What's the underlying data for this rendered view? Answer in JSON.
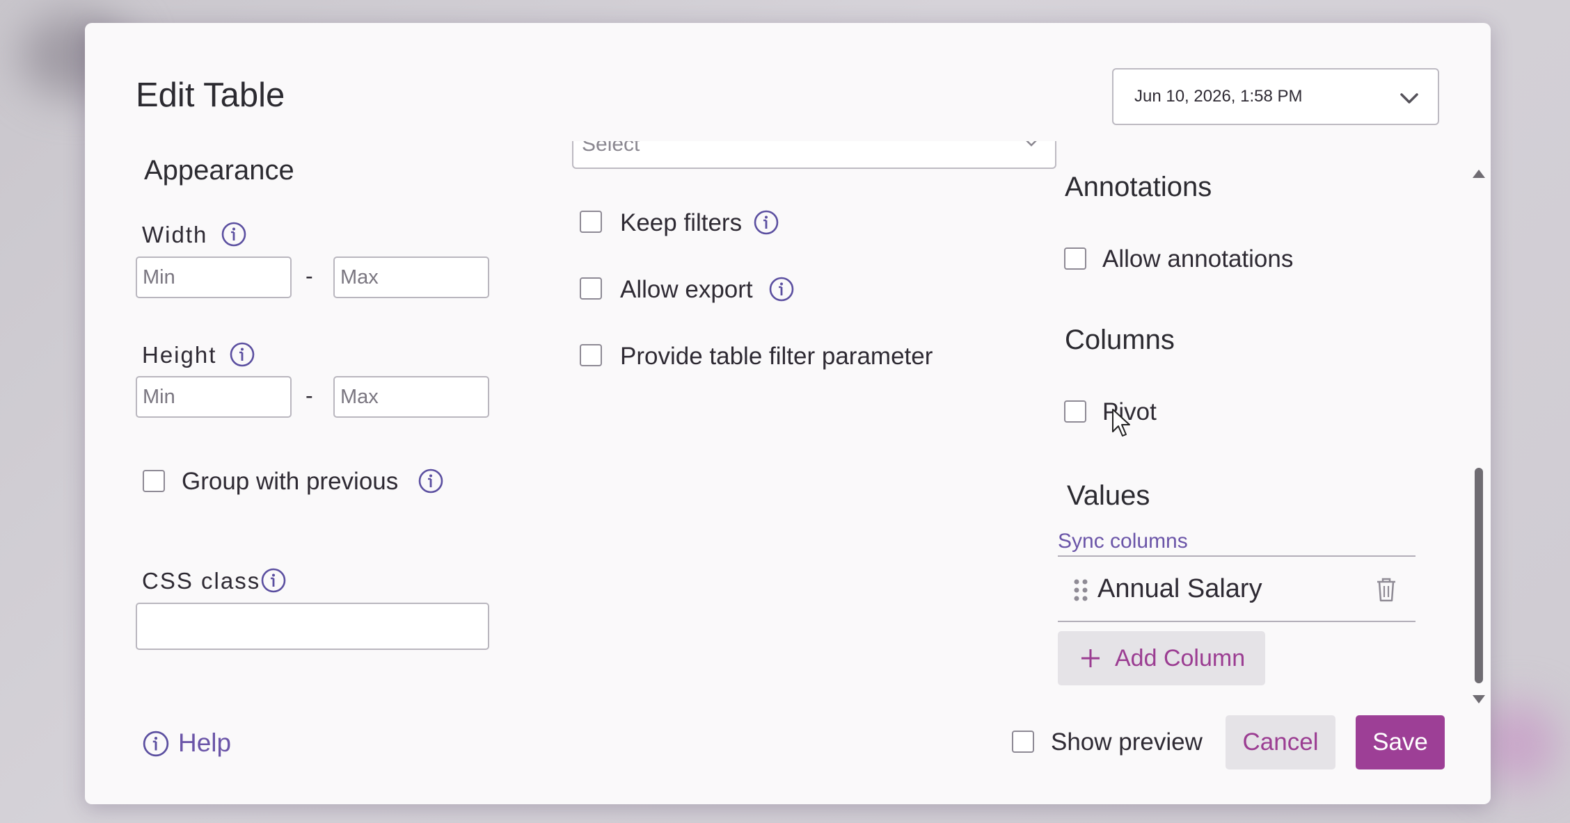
{
  "dialog": {
    "title": "Edit Table",
    "date_selector": {
      "value": "Jun 10, 2026, 1:58 PM",
      "icon": "chevron-down-icon"
    }
  },
  "appearance": {
    "heading": "Appearance",
    "width": {
      "label": "Width",
      "min_placeholder": "Min",
      "max_placeholder": "Max",
      "separator": "-"
    },
    "height": {
      "label": "Height",
      "min_placeholder": "Min",
      "max_placeholder": "Max",
      "separator": "-"
    },
    "group_with_previous": {
      "label": "Group with previous",
      "checked": false
    },
    "css_class": {
      "label": "CSS class",
      "value": ""
    }
  },
  "middle": {
    "select_placeholder": "Select",
    "options": [
      {
        "label": "Keep filters",
        "checked": false,
        "info": true
      },
      {
        "label": "Allow export",
        "checked": false,
        "info": true
      },
      {
        "label": "Provide table filter parameter",
        "checked": false,
        "info": false
      }
    ]
  },
  "annotations": {
    "heading": "Annotations",
    "allow_annotations": {
      "label": "Allow annotations",
      "checked": false
    }
  },
  "columns": {
    "heading": "Columns",
    "pivot": {
      "label": "Pivot",
      "checked": false
    }
  },
  "values": {
    "heading": "Values",
    "sync_link": "Sync columns",
    "items": [
      {
        "label": "Annual Salary"
      }
    ],
    "add_button": "Add Column"
  },
  "footer": {
    "help": "Help",
    "show_preview": {
      "label": "Show preview",
      "checked": false
    },
    "cancel": "Cancel",
    "save": "Save"
  },
  "colors": {
    "accent": "#9d3f96",
    "link": "#6b55a8",
    "background": "#faf9fa"
  }
}
